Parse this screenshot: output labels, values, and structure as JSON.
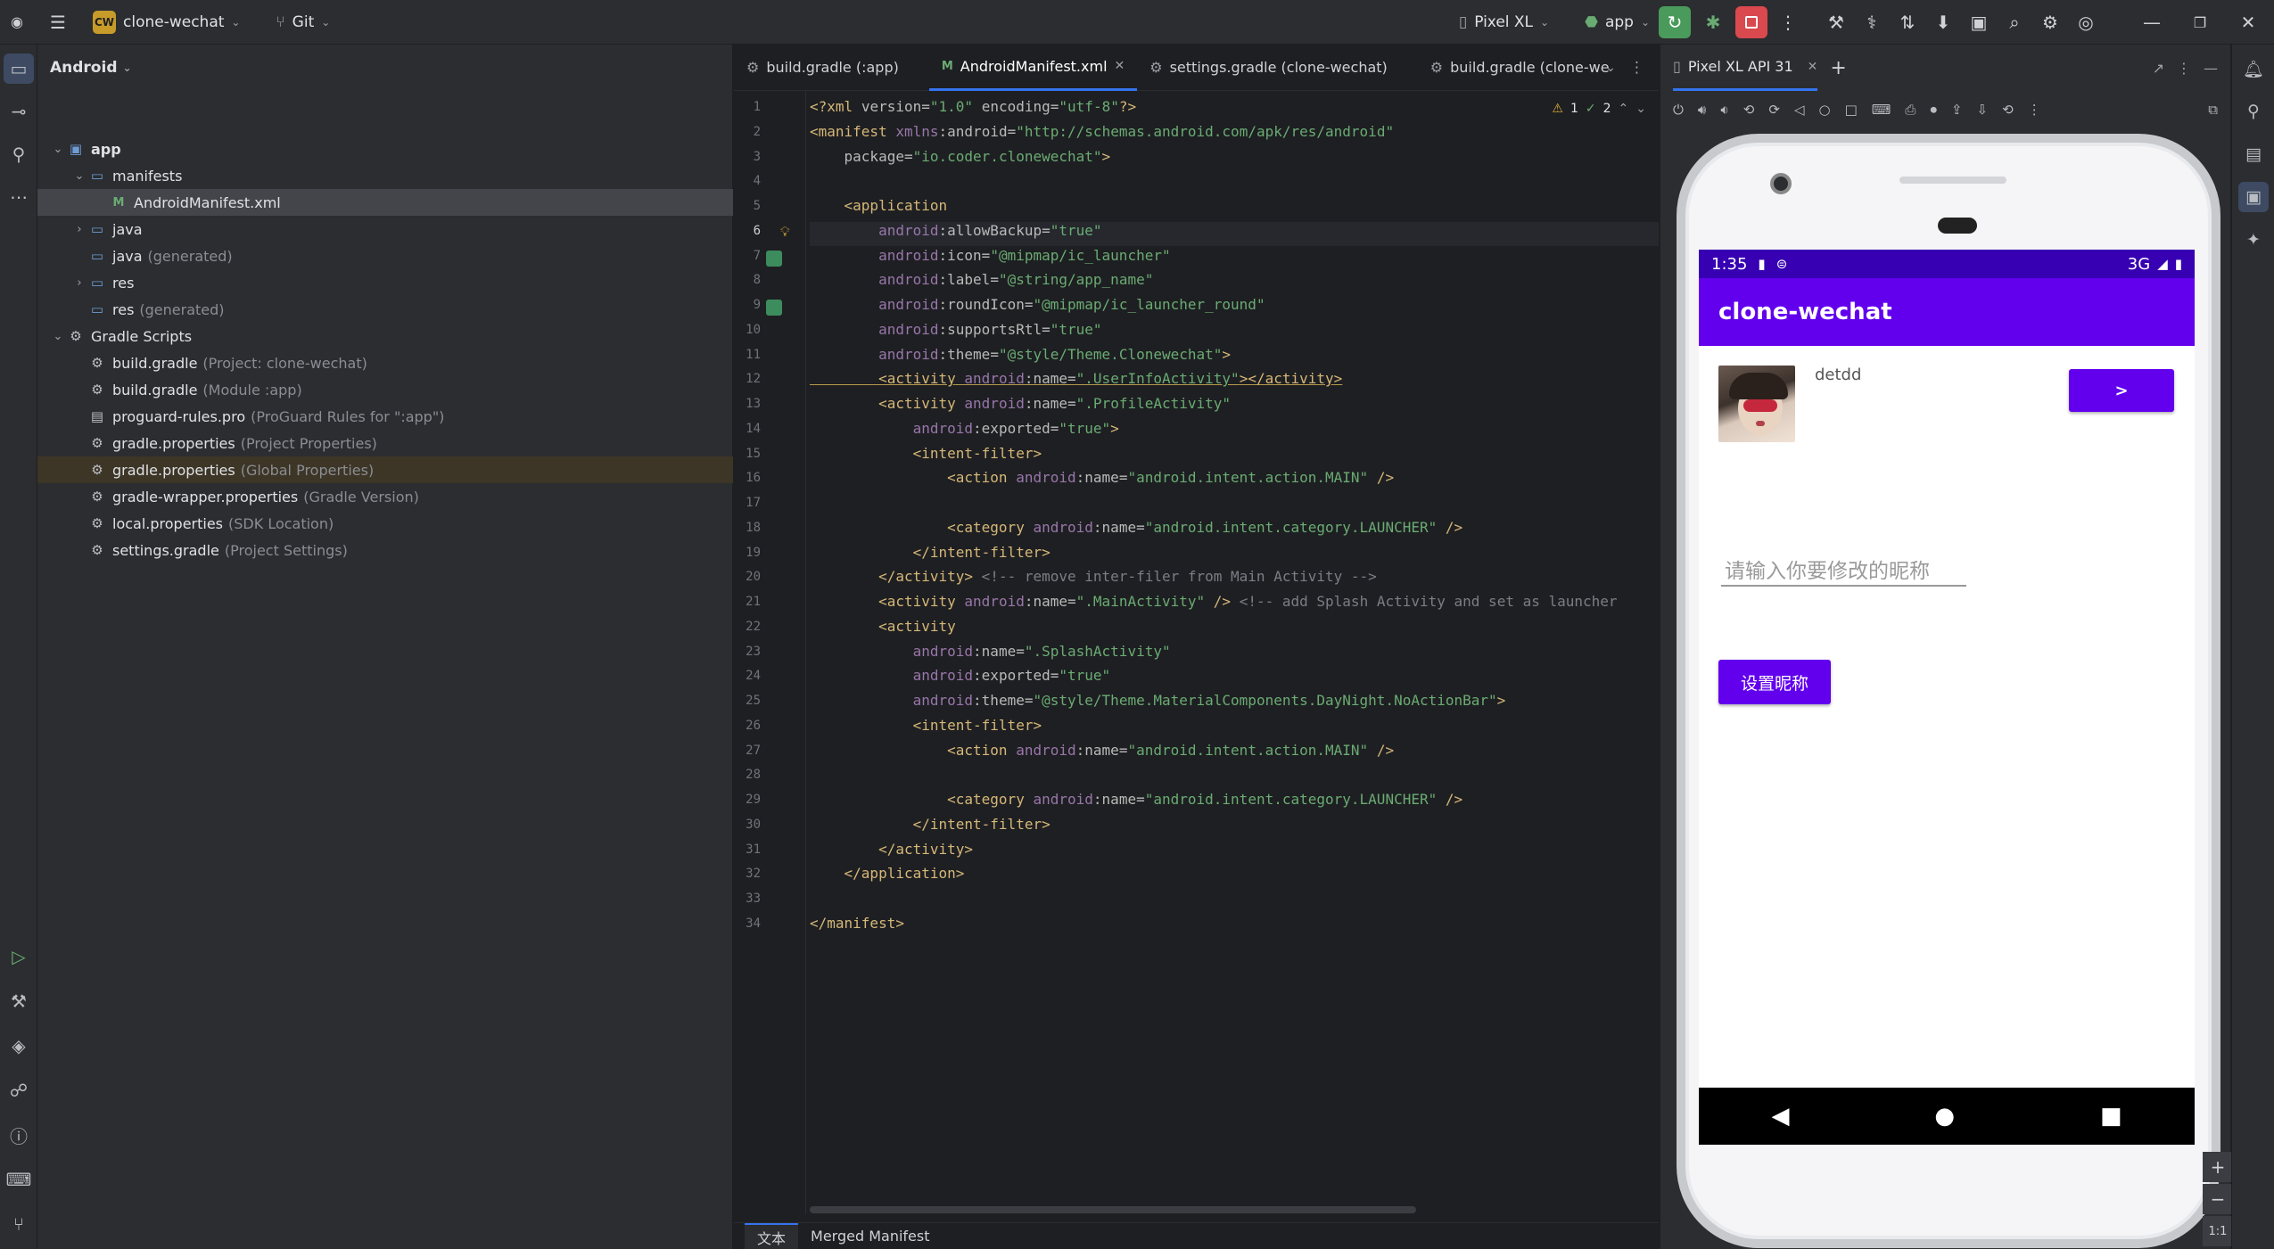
{
  "titlebar": {
    "project_badge": "CW",
    "project_name": "clone-wechat",
    "vcs": "Git",
    "device": "Pixel XL",
    "run_config": "app"
  },
  "project_panel": {
    "view_mode": "Android",
    "tree": [
      {
        "label": "app",
        "hint": "",
        "icon": "folder-module-icon",
        "depth": 0,
        "chev": "v"
      },
      {
        "label": "manifests",
        "hint": "",
        "icon": "folder-icon",
        "depth": 1,
        "chev": "v"
      },
      {
        "label": "AndroidManifest.xml",
        "hint": "",
        "icon": "manifest-file-icon",
        "depth": 2,
        "chev": ""
      },
      {
        "label": "java",
        "hint": "",
        "icon": "folder-icon",
        "depth": 1,
        "chev": ">"
      },
      {
        "label": "java",
        "hint": "(generated)",
        "icon": "folder-icon",
        "depth": 1,
        "chev": ""
      },
      {
        "label": "res",
        "hint": "",
        "icon": "folder-icon",
        "depth": 1,
        "chev": ">"
      },
      {
        "label": "res",
        "hint": "(generated)",
        "icon": "folder-icon",
        "depth": 1,
        "chev": ""
      },
      {
        "label": "Gradle Scripts",
        "hint": "",
        "icon": "gradle-icon",
        "depth": 0,
        "chev": "v"
      },
      {
        "label": "build.gradle",
        "hint": "(Project: clone-wechat)",
        "icon": "gradle-icon",
        "depth": 1,
        "chev": ""
      },
      {
        "label": "build.gradle",
        "hint": "(Module :app)",
        "icon": "gradle-icon",
        "depth": 1,
        "chev": ""
      },
      {
        "label": "proguard-rules.pro",
        "hint": "(ProGuard Rules for \":app\")",
        "icon": "file-icon",
        "depth": 1,
        "chev": ""
      },
      {
        "label": "gradle.properties",
        "hint": "(Project Properties)",
        "icon": "gear-icon",
        "depth": 1,
        "chev": ""
      },
      {
        "label": "gradle.properties",
        "hint": "(Global Properties)",
        "icon": "gear-icon",
        "depth": 1,
        "chev": ""
      },
      {
        "label": "gradle-wrapper.properties",
        "hint": "(Gradle Version)",
        "icon": "gear-icon",
        "depth": 1,
        "chev": ""
      },
      {
        "label": "local.properties",
        "hint": "(SDK Location)",
        "icon": "gear-icon",
        "depth": 1,
        "chev": ""
      },
      {
        "label": "settings.gradle",
        "hint": "(Project Settings)",
        "icon": "gradle-icon",
        "depth": 1,
        "chev": ""
      }
    ]
  },
  "editor": {
    "tabs": [
      {
        "label": "build.gradle (:app)",
        "active": false
      },
      {
        "label": "AndroidManifest.xml",
        "active": true
      },
      {
        "label": "settings.gradle (clone-wechat)",
        "active": false
      },
      {
        "label": "build.gradle (clone-we",
        "active": false
      }
    ],
    "inspections": {
      "warnings": "1",
      "ok": "2"
    },
    "lines": [
      "<?xml version=\"1.0\" encoding=\"utf-8\"?>",
      "<manifest xmlns:android=\"http://schemas.android.com/apk/res/android\"",
      "    package=\"io.coder.clonewechat\">",
      "",
      "    <application",
      "        android:allowBackup=\"true\"",
      "        android:icon=\"@mipmap/ic_launcher\"",
      "        android:label=\"@string/app_name\"",
      "        android:roundIcon=\"@mipmap/ic_launcher_round\"",
      "        android:supportsRtl=\"true\"",
      "        android:theme=\"@style/Theme.Clonewechat\">",
      "        <activity android:name=\".UserInfoActivity\"></activity>",
      "        <activity android:name=\".ProfileActivity\"",
      "            android:exported=\"true\">",
      "            <intent-filter>",
      "                <action android:name=\"android.intent.action.MAIN\" />",
      "",
      "                <category android:name=\"android.intent.category.LAUNCHER\" />",
      "            </intent-filter>",
      "        </activity> <!-- remove inter-filer from Main Activity -->",
      "        <activity android:name=\".MainActivity\" /> <!-- add Splash Activity and set as launcher",
      "        <activity",
      "            android:name=\".SplashActivity\"",
      "            android:exported=\"true\"",
      "            android:theme=\"@style/Theme.MaterialComponents.DayNight.NoActionBar\">",
      "            <intent-filter>",
      "                <action android:name=\"android.intent.action.MAIN\" />",
      "",
      "                <category android:name=\"android.intent.category.LAUNCHER\" />",
      "            </intent-filter>",
      "        </activity>",
      "    </application>",
      "",
      "</manifest>"
    ],
    "line_numbers": [
      "1",
      "2",
      "3",
      "4",
      "5",
      "6",
      "7",
      "8",
      "9",
      "10",
      "11",
      "12",
      "13",
      "14",
      "15",
      "16",
      "17",
      "18",
      "19",
      "20",
      "21",
      "22",
      "23",
      "24",
      "25",
      "26",
      "27",
      "28",
      "29",
      "30",
      "31",
      "32",
      "33",
      "34"
    ],
    "bottom_tabs": [
      "文本",
      "Merged Manifest"
    ]
  },
  "device": {
    "tab_label": "Pixel XL API 31",
    "status_time": "1:35",
    "status_network": "3G",
    "app_title": "clone-wechat",
    "username": "detdd",
    "go_button": ">",
    "nickname_placeholder": "请输入你要修改的昵称",
    "set_button": "设置昵称",
    "zoom_ratio": "1:1"
  },
  "colors": {
    "primary": "#6200ee",
    "primary_dark": "#3700b3",
    "ide_bg": "#1e1f22",
    "ide_panel": "#2b2d30"
  }
}
